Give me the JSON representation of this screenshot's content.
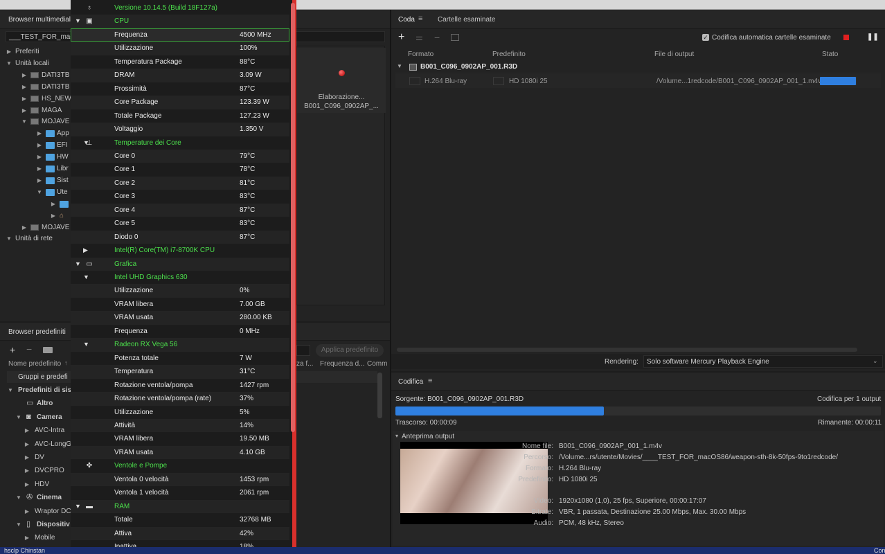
{
  "left_panel": {
    "title": "Browser multimediale",
    "path_value": "___TEST_FOR_macO",
    "tree": [
      {
        "label": "Preferiti",
        "level": 0,
        "arrow": "▶"
      },
      {
        "label": "Unità locali",
        "level": 0,
        "arrow": "▼"
      },
      {
        "label": "DATI3TB",
        "level": 1,
        "arrow": "▶",
        "kind": "drive"
      },
      {
        "label": "DATI3TB",
        "level": 1,
        "arrow": "▶",
        "kind": "drive"
      },
      {
        "label": "HS_NEW",
        "level": 1,
        "arrow": "▶",
        "kind": "drive"
      },
      {
        "label": "MAGA",
        "level": 1,
        "arrow": "▶",
        "kind": "drive"
      },
      {
        "label": "MOJAVE",
        "level": 1,
        "arrow": "▼",
        "kind": "drive"
      },
      {
        "label": "App",
        "level": 2,
        "arrow": "▶",
        "kind": "folder"
      },
      {
        "label": "EFI",
        "level": 2,
        "arrow": "▶",
        "kind": "folder"
      },
      {
        "label": "HW",
        "level": 2,
        "arrow": "▶",
        "kind": "folder"
      },
      {
        "label": "Libr",
        "level": 2,
        "arrow": "▶",
        "kind": "folder"
      },
      {
        "label": "Sist",
        "level": 2,
        "arrow": "▶",
        "kind": "folder"
      },
      {
        "label": "Ute",
        "level": 2,
        "arrow": "▼",
        "kind": "folder"
      },
      {
        "label": "",
        "level": 3,
        "arrow": "▶",
        "kind": "folder"
      },
      {
        "label": "",
        "level": 3,
        "arrow": "▶",
        "kind": "home"
      },
      {
        "label": "MOJAVE",
        "level": 1,
        "arrow": "▶",
        "kind": "drive"
      },
      {
        "label": "Unità di rete",
        "level": 0,
        "arrow": "▼"
      }
    ]
  },
  "preview_tile": {
    "line1": "Elaborazione...",
    "line2": "B001_C096_0902AP_..."
  },
  "presets_panel": {
    "title": "Browser predefiniti",
    "apply_label": "Applica predefinito",
    "columns": [
      "Nome predefinito",
      "za f...",
      "Frequenza d...",
      "Comm"
    ],
    "groups_header": "Gruppi e predefi",
    "tree": [
      {
        "label": "Predefiniti di sist",
        "level": 0,
        "arrow": "▼"
      },
      {
        "label": "Altro",
        "level": 1,
        "arrow": "",
        "icon": "monitor"
      },
      {
        "label": "Camera",
        "level": 1,
        "arrow": "▼",
        "icon": "camera"
      },
      {
        "label": "AVC-Intra",
        "level": 2,
        "arrow": "▶"
      },
      {
        "label": "AVC-LongG",
        "level": 2,
        "arrow": "▶"
      },
      {
        "label": "DV",
        "level": 2,
        "arrow": "▶"
      },
      {
        "label": "DVCPRO",
        "level": 2,
        "arrow": "▶"
      },
      {
        "label": "HDV",
        "level": 2,
        "arrow": "▶"
      },
      {
        "label": "Cinema",
        "level": 1,
        "arrow": "▼",
        "icon": "reel"
      },
      {
        "label": "Wraptor DC",
        "level": 2,
        "arrow": "▶"
      },
      {
        "label": "Dispositiv",
        "level": 1,
        "arrow": "▼",
        "icon": "device"
      },
      {
        "label": "Mobile",
        "level": 2,
        "arrow": "▶"
      }
    ]
  },
  "monitor": {
    "rows": [
      {
        "label": "Versione 10.14.5 (Build 18F127a)",
        "value": "",
        "green": true,
        "icon": "apple",
        "tri": ""
      },
      {
        "label": "CPU",
        "value": "",
        "green": true,
        "icon": "chip",
        "tri": "▼"
      },
      {
        "label": "Frequenza",
        "value": "4500 MHz",
        "selected": true
      },
      {
        "label": "Utilizzazione",
        "value": "100%"
      },
      {
        "label": "Temperatura Package",
        "value": "88°C"
      },
      {
        "label": "DRAM",
        "value": "3.09 W"
      },
      {
        "label": "Prossimità",
        "value": "87°C"
      },
      {
        "label": "Core Package",
        "value": "123.39 W"
      },
      {
        "label": "Totale Package",
        "value": "127.23 W"
      },
      {
        "label": "Voltaggio",
        "value": "1.350 V"
      },
      {
        "label": "Temperature dei Core",
        "value": "",
        "green": true,
        "icon": "thermo",
        "tri2": "▼"
      },
      {
        "label": "Core 0",
        "value": "79°C"
      },
      {
        "label": "Core 1",
        "value": "78°C"
      },
      {
        "label": "Core 2",
        "value": "81°C"
      },
      {
        "label": "Core 3",
        "value": "83°C"
      },
      {
        "label": "Core 4",
        "value": "87°C"
      },
      {
        "label": "Core 5",
        "value": "83°C"
      },
      {
        "label": "Diodo 0",
        "value": "87°C"
      },
      {
        "label": "Intel(R) Core(TM) i7-8700K CPU",
        "value": "",
        "green": true,
        "tri2": "▶"
      },
      {
        "label": "Grafica",
        "value": "",
        "green": true,
        "icon": "gpu",
        "tri": "▼"
      },
      {
        "label": "Intel UHD Graphics 630",
        "value": "",
        "green": true,
        "tri2": "▼"
      },
      {
        "label": "Utilizzazione",
        "value": "0%"
      },
      {
        "label": "VRAM libera",
        "value": "7.00 GB"
      },
      {
        "label": "VRAM usata",
        "value": "280.00 KB"
      },
      {
        "label": "Frequenza",
        "value": "0 MHz"
      },
      {
        "label": "Radeon RX Vega 56",
        "value": "",
        "green": true,
        "tri2": "▼"
      },
      {
        "label": "Potenza totale",
        "value": "7 W"
      },
      {
        "label": "Temperatura",
        "value": "31°C"
      },
      {
        "label": "Rotazione ventola/pompa",
        "value": "1427 rpm"
      },
      {
        "label": "Rotazione ventola/pompa (rate)",
        "value": "37%"
      },
      {
        "label": "Utilizzazione",
        "value": "5%"
      },
      {
        "label": "Attività",
        "value": "14%"
      },
      {
        "label": "VRAM libera",
        "value": "19.50 MB"
      },
      {
        "label": "VRAM usata",
        "value": "4.10 GB"
      },
      {
        "label": "Ventole e Pompe",
        "value": "",
        "green": true,
        "icon": "fan",
        "tri": ""
      },
      {
        "label": "Ventola 0 velocità",
        "value": "1453 rpm"
      },
      {
        "label": "Ventola 1 velocità",
        "value": "2061 rpm"
      },
      {
        "label": "RAM",
        "value": "",
        "green": true,
        "icon": "ram",
        "tri": "▼"
      },
      {
        "label": "Totale",
        "value": "32768 MB"
      },
      {
        "label": "Attiva",
        "value": "42%"
      },
      {
        "label": "Inattiva",
        "value": "18%"
      }
    ]
  },
  "queue": {
    "tab_active": "Coda",
    "tab_other": "Cartelle esaminate",
    "auto_encode_label": "Codifica automatica cartelle esaminate",
    "auto_encode_checked": true,
    "columns": {
      "format": "Formato",
      "preset": "Predefinito",
      "output": "File di output",
      "status": "Stato"
    },
    "item": {
      "name": "B001_C096_0902AP_001.R3D",
      "format": "H.264 Blu-ray",
      "preset": "HD 1080i 25",
      "output": "/Volume...1redcode/B001_C096_0902AP_001_1.m4v",
      "progress": 0.98
    },
    "rendering_label": "Rendering:",
    "rendering_value": "Solo software Mercury Playback Engine"
  },
  "encode": {
    "title": "Codifica",
    "source_label": "Sorgente: B001_C096_0902AP_001.R3D",
    "encoding_for": "Codifica per 1 output",
    "progress": 0.43,
    "elapsed": "Trascorso: 00:00:09",
    "remaining": "Rimanente: 00:00:11",
    "preview_label": "Anteprima output",
    "meta": [
      {
        "k": "Nome file:",
        "v": "B001_C096_0902AP_001_1.m4v"
      },
      {
        "k": "Percorso:",
        "v": "/Volume...rs/utente/Movies/____TEST_FOR_macOS86/weapon-sth-8k-50fps-9to1redcode/"
      },
      {
        "k": "Formato:",
        "v": "H.264 Blu-ray"
      },
      {
        "k": "Predefinito:",
        "v": "HD 1080i 25"
      },
      {
        "k": "Video:",
        "v": "1920x1080 (1,0), 25 fps, Superiore, 00:00:17:07"
      },
      {
        "k": "Bitrate:",
        "v": "VBR, 1 passata, Destinazione 25.00 Mbps, Max. 30.00 Mbps"
      },
      {
        "k": "Audio:",
        "v": "PCM, 48 kHz, Stereo"
      }
    ]
  },
  "bottom": {
    "left_text": "hsclp  Chinstan",
    "right_text": "Cons"
  },
  "colors": {
    "accent": "#2f7fe0",
    "monitor_green": "#4ce04c",
    "monitor_border": "#d9302c"
  }
}
